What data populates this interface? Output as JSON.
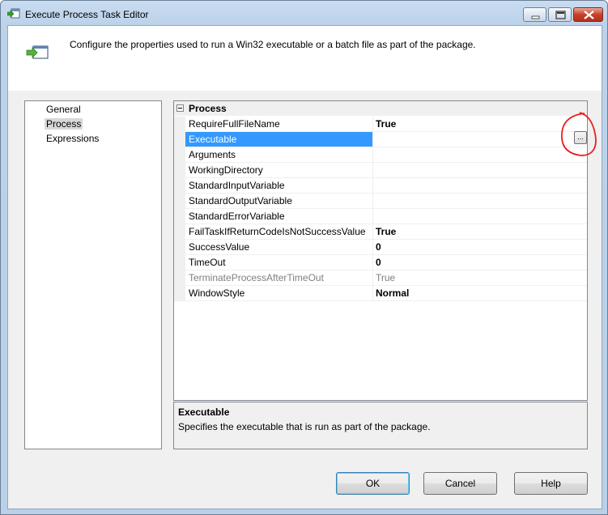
{
  "window": {
    "title": "Execute Process Task Editor"
  },
  "header": {
    "description": "Configure the properties used to run a Win32 executable or a batch file as part of the package."
  },
  "nav": {
    "items": [
      {
        "label": "General"
      },
      {
        "label": "Process"
      },
      {
        "label": "Expressions"
      }
    ]
  },
  "grid": {
    "category": "Process",
    "rows": [
      {
        "name": "RequireFullFileName",
        "value": "True"
      },
      {
        "name": "Executable",
        "value": ""
      },
      {
        "name": "Arguments",
        "value": ""
      },
      {
        "name": "WorkingDirectory",
        "value": ""
      },
      {
        "name": "StandardInputVariable",
        "value": ""
      },
      {
        "name": "StandardOutputVariable",
        "value": ""
      },
      {
        "name": "StandardErrorVariable",
        "value": ""
      },
      {
        "name": "FailTaskIfReturnCodeIsNotSuccessValue",
        "value": "True"
      },
      {
        "name": "SuccessValue",
        "value": "0"
      },
      {
        "name": "TimeOut",
        "value": "0"
      },
      {
        "name": "TerminateProcessAfterTimeOut",
        "value": "True"
      },
      {
        "name": "WindowStyle",
        "value": "Normal"
      }
    ],
    "browse_label": "..."
  },
  "description": {
    "title": "Executable",
    "text": "Specifies the executable that is run as part of the package."
  },
  "buttons": {
    "ok": "OK",
    "cancel": "Cancel",
    "help": "Help"
  },
  "colors": {
    "selection": "#3399ff",
    "annotation": "#e8201a"
  }
}
